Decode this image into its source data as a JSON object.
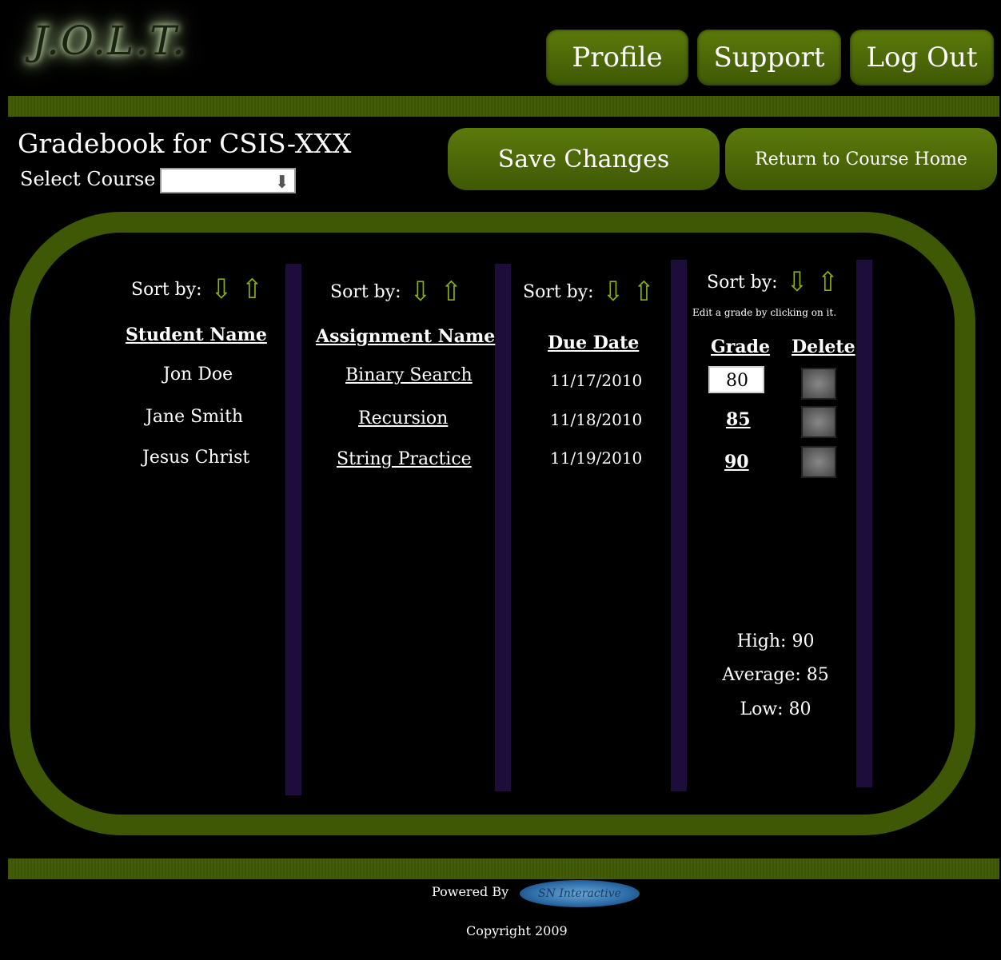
{
  "header": {
    "logo": "J.O.L.T.",
    "nav": [
      "Profile",
      "Support",
      "Log Out"
    ]
  },
  "page": {
    "title": "Gradebook for CSIS-XXX",
    "select_label": "Select Course",
    "save_label": "Save Changes",
    "return_label": "Return to Course Home"
  },
  "sort_label": "Sort by:",
  "columns": {
    "student": {
      "header": "Student Name",
      "rows": [
        "Jon Doe",
        "Jane Smith",
        "Jesus Christ"
      ]
    },
    "assignment": {
      "header": "Assignment Name",
      "rows": [
        "Binary Search",
        "Recursion",
        "String Practice"
      ]
    },
    "due": {
      "header": "Due Date",
      "rows": [
        "11/17/2010",
        "11/18/2010",
        "11/19/2010"
      ]
    },
    "grade": {
      "header": "Grade",
      "rows": [
        "80",
        "85",
        "90"
      ],
      "hint": "Edit a grade by clicking on it."
    },
    "delete": {
      "header": "Delete"
    }
  },
  "stats": {
    "high": "High: 90",
    "average": "Average: 85",
    "low": "Low: 80"
  },
  "footer": {
    "powered": "Powered By",
    "brand": "SN Interactive",
    "copyright": "Copyright 2009"
  }
}
